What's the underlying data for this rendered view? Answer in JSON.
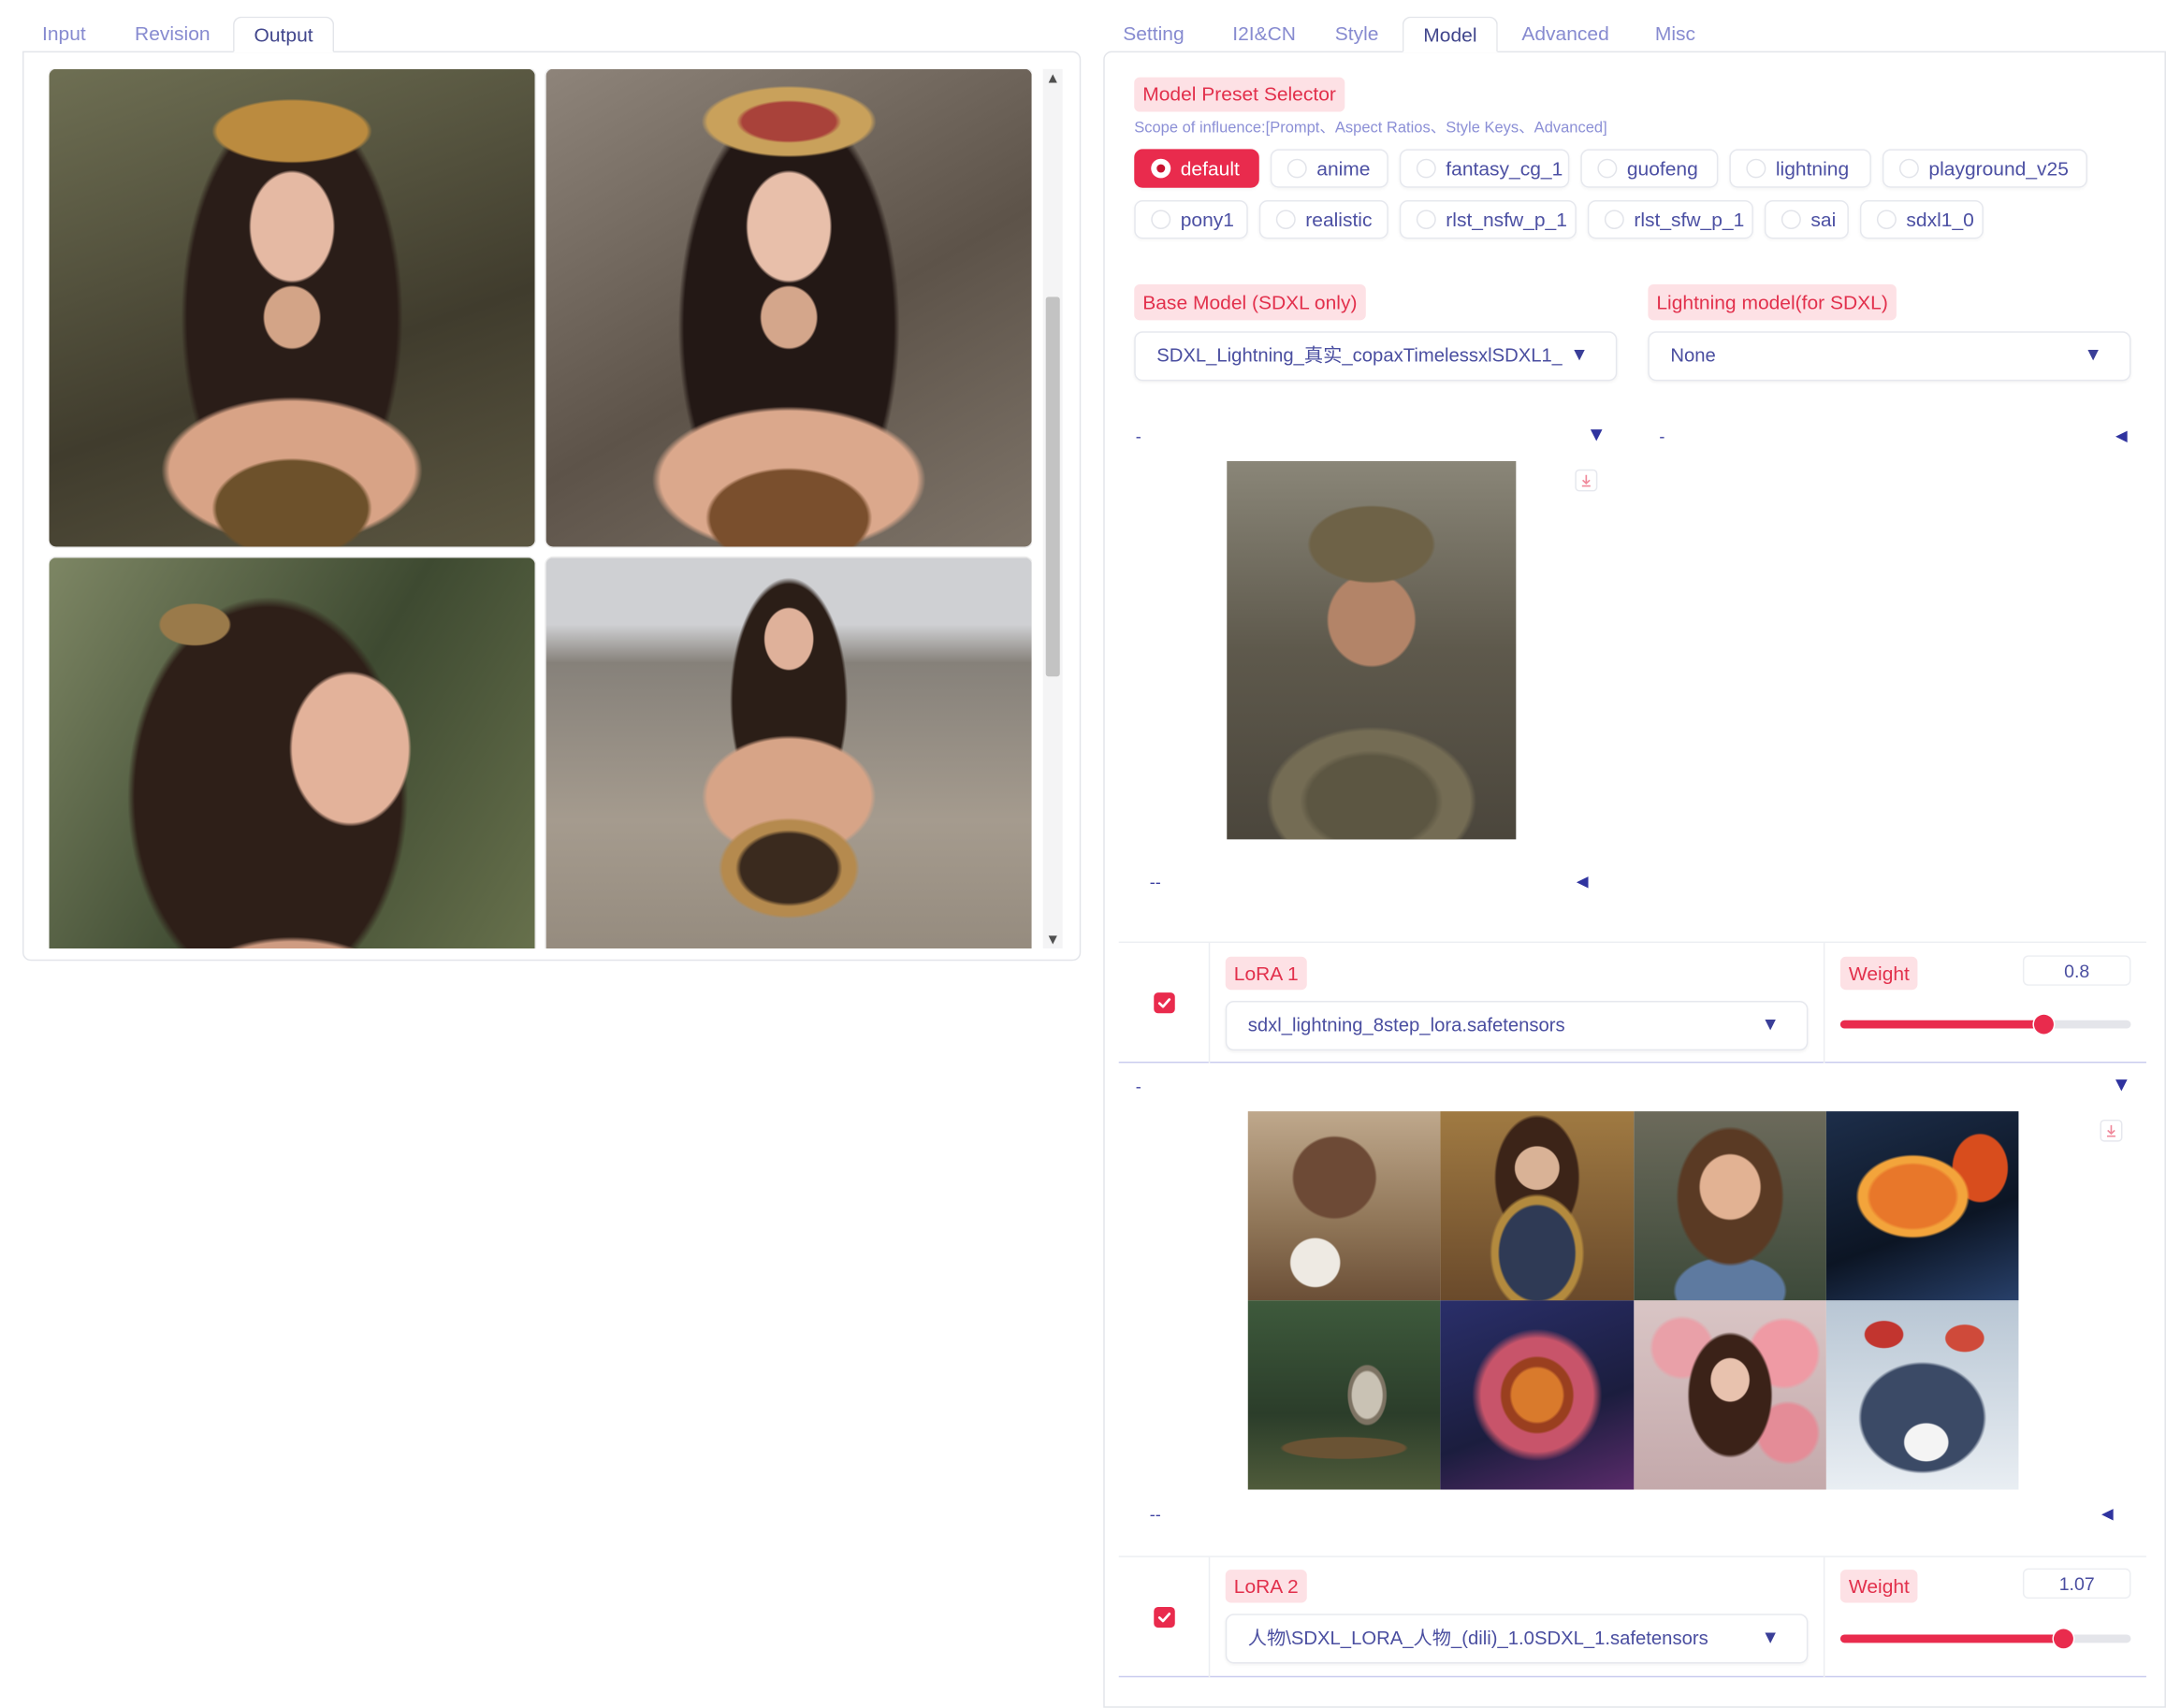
{
  "left_panel": {
    "tabs": [
      {
        "label": "Input",
        "selected": false
      },
      {
        "label": "Revision",
        "selected": false
      },
      {
        "label": "Output",
        "selected": true
      }
    ],
    "gallery": {
      "scroll_up_icon": "scroll-up-arrow-icon",
      "scroll_down_icon": "scroll-down-arrow-icon"
    }
  },
  "right_panel": {
    "tabs": [
      {
        "label": "Setting",
        "selected": false
      },
      {
        "label": "I2I&CN",
        "selected": false
      },
      {
        "label": "Style",
        "selected": false
      },
      {
        "label": "Model",
        "selected": true
      },
      {
        "label": "Advanced",
        "selected": false
      },
      {
        "label": "Misc",
        "selected": false
      }
    ],
    "preset": {
      "label": "Model Preset Selector",
      "scope": "Scope of influence:[Prompt、Aspect Ratios、Style Keys、Advanced]",
      "options": [
        {
          "label": "default",
          "selected": true
        },
        {
          "label": "anime",
          "selected": false
        },
        {
          "label": "fantasy_cg_1",
          "selected": false
        },
        {
          "label": "guofeng",
          "selected": false
        },
        {
          "label": "lightning",
          "selected": false
        },
        {
          "label": "playground_v25",
          "selected": false
        },
        {
          "label": "pony1",
          "selected": false
        },
        {
          "label": "realistic",
          "selected": false
        },
        {
          "label": "rlst_nsfw_p_1",
          "selected": false
        },
        {
          "label": "rlst_sfw_p_1",
          "selected": false
        },
        {
          "label": "sai",
          "selected": false
        },
        {
          "label": "sdxl1_0",
          "selected": false
        }
      ]
    },
    "base_model": {
      "label": "Base Model (SDXL only)",
      "value": "SDXL_Lightning_真实_copaxTimelessxlSDXL1_",
      "caret_icon": "chevron-down-icon"
    },
    "lightning_model": {
      "label": "Lightning model(for SDXL)",
      "value": "None",
      "caret_icon": "chevron-down-icon"
    },
    "base_model_preview": {
      "top_marker": "-",
      "bottom_marker": "--",
      "collapse_icon": "caret-down-icon",
      "expand_icon": "caret-left-icon",
      "download_icon": "download-icon"
    },
    "lightning_model_preview": {
      "top_marker": "-",
      "toggle_icon": "caret-left-icon"
    },
    "loras": [
      {
        "label": "LoRA 1",
        "enabled": true,
        "value": "sdxl_lightning_8step_lora.safetensors",
        "weight_label": "Weight",
        "weight": "0.8"
      },
      {
        "label": "LoRA 2",
        "enabled": true,
        "value": "人物\\SDXL_LORA_人物_(dili)_1.0SDXL_1.safetensors",
        "weight_label": "Weight",
        "weight": "1.07"
      }
    ],
    "lora_preview": {
      "top_marker": "-",
      "bottom_marker": "--",
      "collapse_icon": "caret-down-icon",
      "expand_icon": "caret-left-icon",
      "download_icon": "download-icon"
    }
  },
  "colors": {
    "accent": "#e92b4d",
    "label_background": "#fde1e5",
    "label_text": "#e2304c",
    "tab_text": "#878bd0",
    "control_text": "#4a4ea0"
  }
}
